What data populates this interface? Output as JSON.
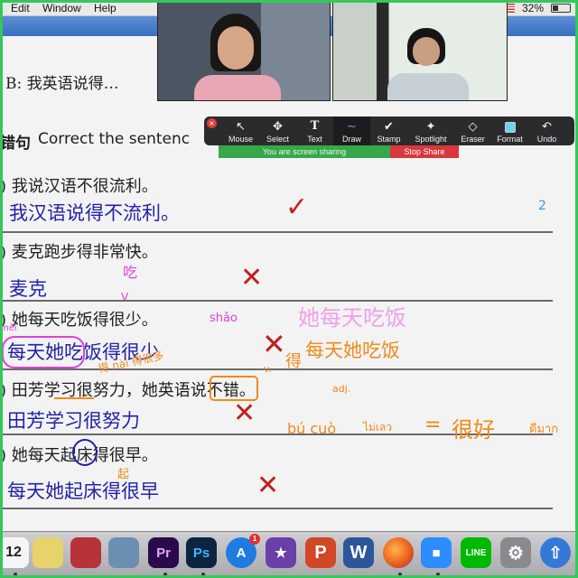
{
  "menubar": {
    "items": [
      "Edit",
      "Window",
      "Help"
    ],
    "battery": "32%"
  },
  "worksheet": {
    "partial_line": "B: 我英语说得…",
    "heading_prefix": "错句",
    "heading": "Correct the sentenc",
    "sentences": [
      {
        "printed": "我说汉语不很流利。",
        "answer": "我汉语说得不流利。"
      },
      {
        "printed": "麦克跑步得非常快。",
        "answer": "麦克"
      },
      {
        "printed": "她每天吃饭得很少。",
        "answer": "每天她吃饭得很少"
      },
      {
        "printed": "田芳学习很努力，她英语说不错。",
        "answer": "田芳学习很努力"
      },
      {
        "printed": "她每天起床得很早。",
        "answer": "每天她起床得很早"
      }
    ]
  },
  "annotations": {
    "pink_chi": "吃",
    "pink_v": "V",
    "pink_shao": "shǎo",
    "pink_mei": "měi",
    "pink_sentence": "她每天吃饭",
    "orange_de_note": "得 nài 得很多",
    "orange_de": "得",
    "orange_v": "v.",
    "orange_adj": "adj.",
    "orange_v2": "V.",
    "orange_answer": "每天她吃饭",
    "orange_bucuo": "bú cuò",
    "orange_thai": "ไม่เลว",
    "orange_eq": "=",
    "orange_henhao": "很好",
    "orange_thai2": "ดีมาก",
    "orange_qi": "起",
    "blue_tick": "2",
    "checkmark": "✓",
    "cross": "✕"
  },
  "toolbar": {
    "close": "×",
    "tools": [
      {
        "label": "Mouse",
        "icon": "cursor-arrow-icon",
        "glyph": "↖"
      },
      {
        "label": "Select",
        "icon": "select-move-icon",
        "glyph": "✥"
      },
      {
        "label": "Text",
        "icon": "text-T-icon",
        "glyph": "T"
      },
      {
        "label": "Draw",
        "icon": "draw-squiggle-icon",
        "glyph": "∼"
      },
      {
        "label": "Stamp",
        "icon": "stamp-check-icon",
        "glyph": "✔"
      },
      {
        "label": "Spotlight",
        "icon": "spotlight-wand-icon",
        "glyph": "✦"
      },
      {
        "label": "Eraser",
        "icon": "eraser-icon",
        "glyph": "◇"
      },
      {
        "label": "Format",
        "icon": "format-swatch-icon",
        "glyph": ""
      },
      {
        "label": "Undo",
        "icon": "undo-arrow-icon",
        "glyph": "↶"
      }
    ],
    "active_tool": "Draw"
  },
  "share_banner": {
    "message": "You are screen sharing",
    "stop": "Stop Share"
  },
  "dock": {
    "calendar_day": "12",
    "badge_count": "1",
    "apps": [
      {
        "name": "calendar-icon",
        "label": "",
        "color": "#f5f5f5"
      },
      {
        "name": "stickies-icon",
        "label": "",
        "color": "#e8d36a"
      },
      {
        "name": "photo-booth-icon",
        "label": "",
        "color": "#b8323a"
      },
      {
        "name": "image-capture-icon",
        "label": "",
        "color": "#6b8fb2"
      },
      {
        "name": "premiere-icon",
        "label": "Pr",
        "color": "#2a0a4a"
      },
      {
        "name": "photoshop-icon",
        "label": "Ps",
        "color": "#0b2540"
      },
      {
        "name": "app-store-icon",
        "label": "A",
        "color": "#1e7be0"
      },
      {
        "name": "imovie-icon",
        "label": "★",
        "color": "#6a3fa8"
      },
      {
        "name": "powerpoint-icon",
        "label": "P",
        "color": "#d24726"
      },
      {
        "name": "word-icon",
        "label": "W",
        "color": "#2b579a"
      },
      {
        "name": "firefox-icon",
        "label": "",
        "color": "#e8591a"
      },
      {
        "name": "zoom-icon",
        "label": "■",
        "color": "#2d8cff"
      },
      {
        "name": "line-icon",
        "label": "LINE",
        "color": "#00b900"
      },
      {
        "name": "system-preferences-icon",
        "label": "⚙",
        "color": "#8a8a8e"
      },
      {
        "name": "software-update-icon",
        "label": "⇧",
        "color": "#3478d8"
      }
    ]
  },
  "colors": {
    "share_green": "#34c759",
    "pen_blue": "#2222a8",
    "pen_pink": "#e23ed8",
    "pen_orange": "#f08a1a",
    "pen_red": "#c02020"
  }
}
